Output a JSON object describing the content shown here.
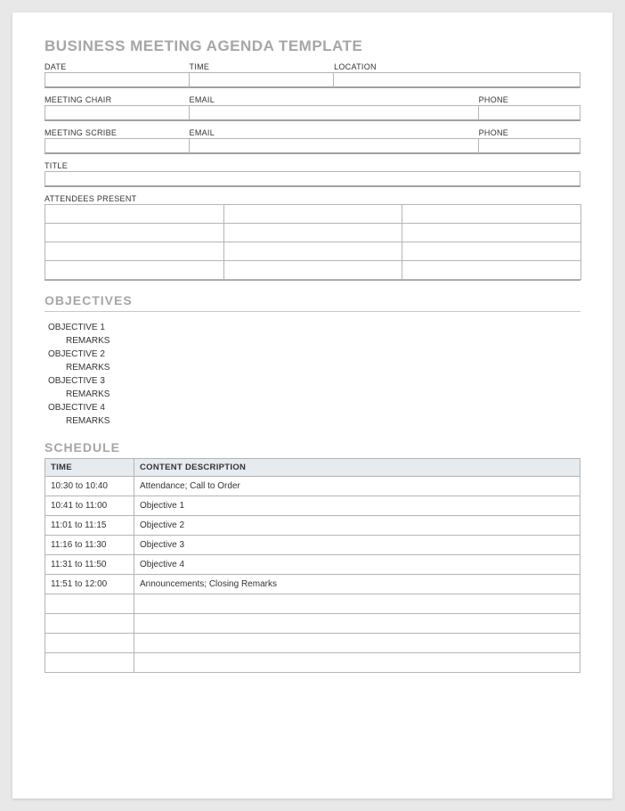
{
  "title": "BUSINESS MEETING AGENDA TEMPLATE",
  "fields": {
    "date_label": "DATE",
    "time_label": "TIME",
    "location_label": "LOCATION",
    "meeting_chair_label": "MEETING CHAIR",
    "email_label": "EMAIL",
    "phone_label": "PHONE",
    "meeting_scribe_label": "MEETING SCRIBE",
    "title_label": "TITLE",
    "attendees_label": "ATTENDEES PRESENT",
    "date": "",
    "time": "",
    "location": "",
    "chair": "",
    "chair_email": "",
    "chair_phone": "",
    "scribe": "",
    "scribe_email": "",
    "scribe_phone": "",
    "meeting_title": ""
  },
  "objectives_heading": "OBJECTIVES",
  "objectives": [
    {
      "name": "OBJECTIVE 1",
      "remarks_label": "REMARKS"
    },
    {
      "name": "OBJECTIVE 2",
      "remarks_label": "REMARKS"
    },
    {
      "name": "OBJECTIVE 3",
      "remarks_label": "REMARKS"
    },
    {
      "name": "OBJECTIVE 4",
      "remarks_label": "REMARKS"
    }
  ],
  "schedule_heading": "SCHEDULE",
  "schedule": {
    "time_header": "TIME",
    "content_header": "CONTENT DESCRIPTION",
    "rows": [
      {
        "time": "10:30 to 10:40",
        "content": "Attendance; Call to Order"
      },
      {
        "time": "10:41 to 11:00",
        "content": "Objective 1"
      },
      {
        "time": "11:01 to 11:15",
        "content": "Objective 2"
      },
      {
        "time": "11:16 to 11:30",
        "content": "Objective 3"
      },
      {
        "time": "11:31 to 11:50",
        "content": "Objective 4"
      },
      {
        "time": "11:51 to 12:00",
        "content": "Announcements; Closing Remarks"
      },
      {
        "time": "",
        "content": ""
      },
      {
        "time": "",
        "content": ""
      },
      {
        "time": "",
        "content": ""
      },
      {
        "time": "",
        "content": ""
      }
    ]
  }
}
